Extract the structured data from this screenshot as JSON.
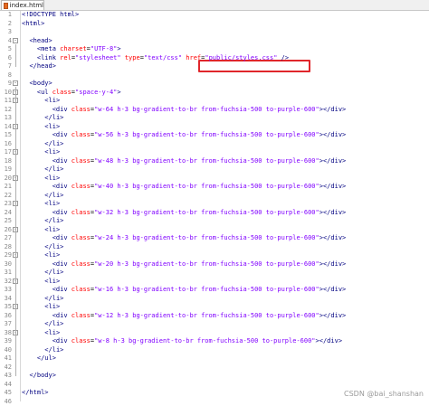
{
  "tab": {
    "label": "index.html"
  },
  "watermark": "CSDN @bai_shanshan",
  "lines": [
    {
      "n": "1",
      "fold": "",
      "indent": 0,
      "tokens": [
        [
          "doc",
          "<!DOCTYPE html>"
        ]
      ]
    },
    {
      "n": "2",
      "fold": "",
      "indent": 0,
      "tokens": [
        [
          "tag",
          "<html>"
        ]
      ]
    },
    {
      "n": "3",
      "fold": "",
      "indent": 0,
      "tokens": []
    },
    {
      "n": "4",
      "fold": "-",
      "indent": 2,
      "tokens": [
        [
          "tag",
          "<head>"
        ]
      ]
    },
    {
      "n": "5",
      "fold": "",
      "indent": 4,
      "tokens": [
        [
          "tag",
          "<meta "
        ],
        [
          "attr",
          "charset"
        ],
        [
          "eq",
          "="
        ],
        [
          "val",
          "\"UTF-8\""
        ],
        [
          "tag",
          ">"
        ]
      ]
    },
    {
      "n": "6",
      "fold": "",
      "indent": 4,
      "tokens": [
        [
          "tag",
          "<link "
        ],
        [
          "attr",
          "rel"
        ],
        [
          "eq",
          "="
        ],
        [
          "val",
          "\"stylesheet\""
        ],
        [
          "txt",
          " "
        ],
        [
          "attr",
          "type"
        ],
        [
          "eq",
          "="
        ],
        [
          "val",
          "\"text/css\""
        ],
        [
          "txt",
          " "
        ],
        [
          "attr",
          "href"
        ],
        [
          "eq",
          "="
        ],
        [
          "val",
          "\"public/styles.css\""
        ],
        [
          "txt",
          " "
        ],
        [
          "tag",
          "/>"
        ]
      ]
    },
    {
      "n": "7",
      "fold": "",
      "indent": 2,
      "tokens": [
        [
          "tag",
          "</head>"
        ]
      ]
    },
    {
      "n": "8",
      "fold": "",
      "indent": 0,
      "tokens": []
    },
    {
      "n": "9",
      "fold": "-",
      "indent": 2,
      "tokens": [
        [
          "tag",
          "<body>"
        ]
      ]
    },
    {
      "n": "10",
      "fold": "-",
      "indent": 4,
      "tokens": [
        [
          "tag",
          "<ul "
        ],
        [
          "attr",
          "class"
        ],
        [
          "eq",
          "="
        ],
        [
          "val",
          "\"space-y-4\""
        ],
        [
          "tag",
          ">"
        ]
      ]
    },
    {
      "n": "11",
      "fold": "-",
      "indent": 6,
      "tokens": [
        [
          "tag",
          "<li>"
        ]
      ]
    },
    {
      "n": "12",
      "fold": "",
      "indent": 8,
      "tokens": [
        [
          "tag",
          "<div "
        ],
        [
          "attr",
          "class"
        ],
        [
          "eq",
          "="
        ],
        [
          "val",
          "\"w-64 h-3 bg-gradient-to-br from-fuchsia-500 to-purple-600\""
        ],
        [
          "tag",
          "></div>"
        ]
      ]
    },
    {
      "n": "13",
      "fold": "",
      "indent": 6,
      "tokens": [
        [
          "tag",
          "</li>"
        ]
      ]
    },
    {
      "n": "14",
      "fold": "-",
      "indent": 6,
      "tokens": [
        [
          "tag",
          "<li>"
        ]
      ]
    },
    {
      "n": "15",
      "fold": "",
      "indent": 8,
      "tokens": [
        [
          "tag",
          "<div "
        ],
        [
          "attr",
          "class"
        ],
        [
          "eq",
          "="
        ],
        [
          "val",
          "\"w-56 h-3 bg-gradient-to-br from-fuchsia-500 to-purple-600\""
        ],
        [
          "tag",
          "></div>"
        ]
      ]
    },
    {
      "n": "16",
      "fold": "",
      "indent": 6,
      "tokens": [
        [
          "tag",
          "</li>"
        ]
      ]
    },
    {
      "n": "17",
      "fold": "-",
      "indent": 6,
      "tokens": [
        [
          "tag",
          "<li>"
        ]
      ]
    },
    {
      "n": "18",
      "fold": "",
      "indent": 8,
      "tokens": [
        [
          "tag",
          "<div "
        ],
        [
          "attr",
          "class"
        ],
        [
          "eq",
          "="
        ],
        [
          "val",
          "\"w-48 h-3 bg-gradient-to-br from-fuchsia-500 to-purple-600\""
        ],
        [
          "tag",
          "></div>"
        ]
      ]
    },
    {
      "n": "19",
      "fold": "",
      "indent": 6,
      "tokens": [
        [
          "tag",
          "</li>"
        ]
      ]
    },
    {
      "n": "20",
      "fold": "-",
      "indent": 6,
      "tokens": [
        [
          "tag",
          "<li>"
        ]
      ]
    },
    {
      "n": "21",
      "fold": "",
      "indent": 8,
      "tokens": [
        [
          "tag",
          "<div "
        ],
        [
          "attr",
          "class"
        ],
        [
          "eq",
          "="
        ],
        [
          "val",
          "\"w-40 h-3 bg-gradient-to-br from-fuchsia-500 to-purple-600\""
        ],
        [
          "tag",
          "></div>"
        ]
      ]
    },
    {
      "n": "22",
      "fold": "",
      "indent": 6,
      "tokens": [
        [
          "tag",
          "</li>"
        ]
      ]
    },
    {
      "n": "23",
      "fold": "-",
      "indent": 6,
      "tokens": [
        [
          "tag",
          "<li>"
        ]
      ]
    },
    {
      "n": "24",
      "fold": "",
      "indent": 8,
      "tokens": [
        [
          "tag",
          "<div "
        ],
        [
          "attr",
          "class"
        ],
        [
          "eq",
          "="
        ],
        [
          "val",
          "\"w-32 h-3 bg-gradient-to-br from-fuchsia-500 to-purple-600\""
        ],
        [
          "tag",
          "></div>"
        ]
      ]
    },
    {
      "n": "25",
      "fold": "",
      "indent": 6,
      "tokens": [
        [
          "tag",
          "</li>"
        ]
      ]
    },
    {
      "n": "26",
      "fold": "-",
      "indent": 6,
      "tokens": [
        [
          "tag",
          "<li>"
        ]
      ]
    },
    {
      "n": "27",
      "fold": "",
      "indent": 8,
      "tokens": [
        [
          "tag",
          "<div "
        ],
        [
          "attr",
          "class"
        ],
        [
          "eq",
          "="
        ],
        [
          "val",
          "\"w-24 h-3 bg-gradient-to-br from-fuchsia-500 to-purple-600\""
        ],
        [
          "tag",
          "></div>"
        ]
      ]
    },
    {
      "n": "28",
      "fold": "",
      "indent": 6,
      "tokens": [
        [
          "tag",
          "</li>"
        ]
      ]
    },
    {
      "n": "29",
      "fold": "-",
      "indent": 6,
      "tokens": [
        [
          "tag",
          "<li>"
        ]
      ]
    },
    {
      "n": "30",
      "fold": "",
      "indent": 8,
      "tokens": [
        [
          "tag",
          "<div "
        ],
        [
          "attr",
          "class"
        ],
        [
          "eq",
          "="
        ],
        [
          "val",
          "\"w-20 h-3 bg-gradient-to-br from-fuchsia-500 to-purple-600\""
        ],
        [
          "tag",
          "></div>"
        ]
      ]
    },
    {
      "n": "31",
      "fold": "",
      "indent": 6,
      "tokens": [
        [
          "tag",
          "</li>"
        ]
      ]
    },
    {
      "n": "32",
      "fold": "-",
      "indent": 6,
      "tokens": [
        [
          "tag",
          "<li>"
        ]
      ]
    },
    {
      "n": "33",
      "fold": "",
      "indent": 8,
      "tokens": [
        [
          "tag",
          "<div "
        ],
        [
          "attr",
          "class"
        ],
        [
          "eq",
          "="
        ],
        [
          "val",
          "\"w-16 h-3 bg-gradient-to-br from-fuchsia-500 to-purple-600\""
        ],
        [
          "tag",
          "></div>"
        ]
      ]
    },
    {
      "n": "34",
      "fold": "",
      "indent": 6,
      "tokens": [
        [
          "tag",
          "</li>"
        ]
      ]
    },
    {
      "n": "35",
      "fold": "-",
      "indent": 6,
      "tokens": [
        [
          "tag",
          "<li>"
        ]
      ]
    },
    {
      "n": "36",
      "fold": "",
      "indent": 8,
      "tokens": [
        [
          "tag",
          "<div "
        ],
        [
          "attr",
          "class"
        ],
        [
          "eq",
          "="
        ],
        [
          "val",
          "\"w-12 h-3 bg-gradient-to-br from-fuchsia-500 to-purple-600\""
        ],
        [
          "tag",
          "></div>"
        ]
      ]
    },
    {
      "n": "37",
      "fold": "",
      "indent": 6,
      "tokens": [
        [
          "tag",
          "</li>"
        ]
      ]
    },
    {
      "n": "38",
      "fold": "-",
      "indent": 6,
      "tokens": [
        [
          "tag",
          "<li>"
        ]
      ]
    },
    {
      "n": "39",
      "fold": "",
      "indent": 8,
      "tokens": [
        [
          "tag",
          "<div "
        ],
        [
          "attr",
          "class"
        ],
        [
          "eq",
          "="
        ],
        [
          "val",
          "\"w-8 h-3 bg-gradient-to-br from-fuchsia-500 to-purple-600\""
        ],
        [
          "tag",
          "></div>"
        ]
      ]
    },
    {
      "n": "40",
      "fold": "",
      "indent": 6,
      "tokens": [
        [
          "tag",
          "</li>"
        ]
      ]
    },
    {
      "n": "41",
      "fold": "",
      "indent": 4,
      "tokens": [
        [
          "tag",
          "</ul>"
        ]
      ]
    },
    {
      "n": "42",
      "fold": "",
      "indent": 0,
      "tokens": []
    },
    {
      "n": "43",
      "fold": "",
      "indent": 2,
      "tokens": [
        [
          "tag",
          "</body>"
        ]
      ]
    },
    {
      "n": "44",
      "fold": "",
      "indent": 0,
      "tokens": []
    },
    {
      "n": "45",
      "fold": "",
      "indent": 0,
      "tokens": [
        [
          "tag",
          "</html>"
        ]
      ]
    },
    {
      "n": "46",
      "fold": "",
      "indent": 0,
      "tokens": []
    }
  ],
  "colors": {
    "tag": "#000080",
    "attr": "#ff0000",
    "value": "#8000ff",
    "highlight_border": "#e0262b"
  }
}
